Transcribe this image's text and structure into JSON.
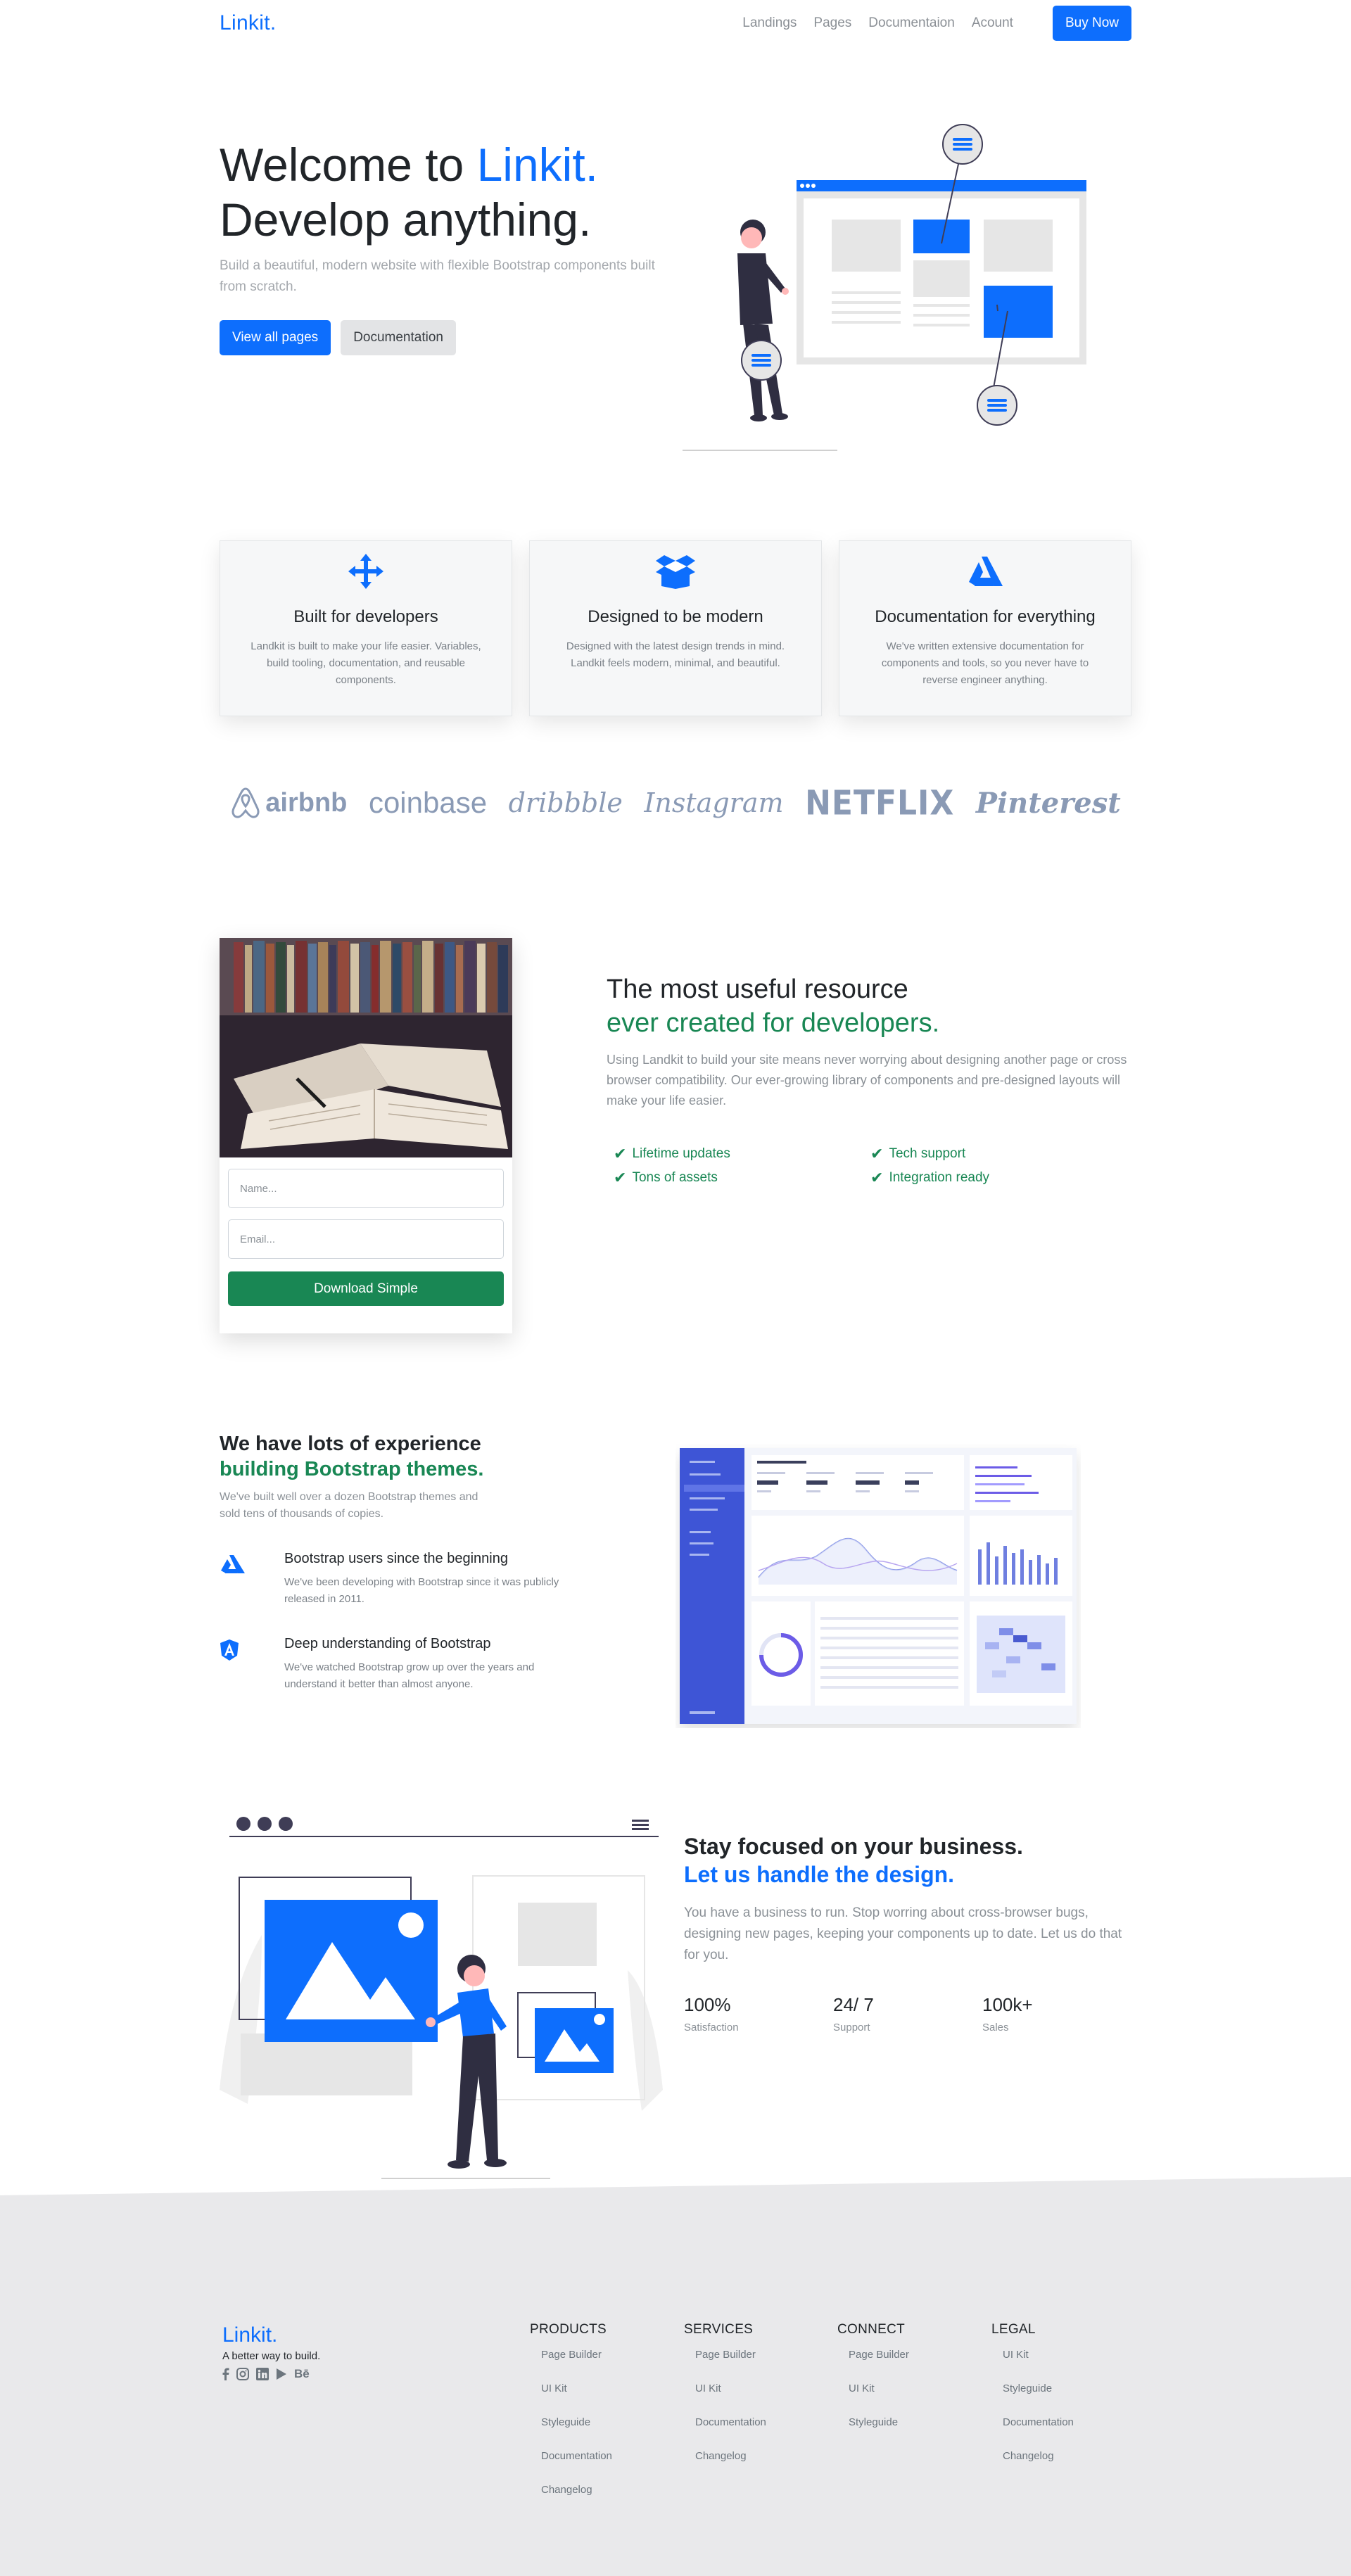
{
  "nav": {
    "brand": "Linkit.",
    "links": [
      "Landings",
      "Pages",
      "Documentaion",
      "Acount"
    ],
    "buy": "Buy Now"
  },
  "hero": {
    "title_prefix": "Welcome to ",
    "title_accent": "Linkit.",
    "title_line2": "Develop anything.",
    "subtitle": "Build a beautiful, modern website with flexible Bootstrap components built from scratch.",
    "btn_primary": "View all pages",
    "btn_secondary": "Documentation"
  },
  "features": [
    {
      "icon": "arrows-move-icon",
      "title": "Built for developers",
      "text": "Landkit is built to make your life easier. Variables, build tooling, documentation, and reusable components."
    },
    {
      "icon": "box-icon",
      "title": "Designed to be modern",
      "text": "Designed with the latest design trends in mind. Landkit feels modern, minimal, and beautiful."
    },
    {
      "icon": "documentation-icon",
      "title": "Documentation for everything",
      "text": "We've written extensive documentation for components and tools, so you never have to reverse engineer anything."
    }
  ],
  "logos": [
    "airbnb",
    "coinbase",
    "dribbble",
    "Instagram",
    "NETFLIX",
    "Pinterest"
  ],
  "resource": {
    "name_placeholder": "Name...",
    "email_placeholder": "Email...",
    "button": "Download Simple",
    "heading1": "The most useful resource",
    "heading2": "ever created for developers.",
    "paragraph": "Using Landkit to build your site means never worrying about designing another page or cross browser compatibility. Our ever-growing library of components and pre-designed layouts will make your life easier.",
    "checks": [
      "Lifetime updates",
      "Tech support",
      "Tons of assets",
      "Integration ready"
    ]
  },
  "experience": {
    "heading1": "We have lots of experience",
    "heading2": "building Bootstrap themes.",
    "subtitle": "We've built well over a dozen Bootstrap themes and sold tens of thousands of copies.",
    "items": [
      {
        "title": "Bootstrap users since the beginning",
        "text": "We've been developing with Bootstrap since it was publicly released in 2011."
      },
      {
        "title": "Deep understanding of Bootstrap",
        "text": "We've watched Bootstrap grow up over the years and understand it better than almost anyone."
      }
    ]
  },
  "focus": {
    "heading1": "Stay focused on your business.",
    "heading2": "Let us handle the design.",
    "paragraph": "You have a business to run. Stop worring about cross-browser bugs, designing new pages, keeping your components up to date. Let us do that for you.",
    "stats": [
      {
        "value": "100%",
        "label": "Satisfaction"
      },
      {
        "value": "24/ 7",
        "label": "Support"
      },
      {
        "value": "100k+",
        "label": "Sales"
      }
    ]
  },
  "footer": {
    "brand": "Linkit.",
    "tagline": "A better way to build.",
    "columns": [
      {
        "title": "PRODUCTS",
        "links": [
          "Page Builder",
          "UI Kit",
          "Styleguide",
          "Documentation",
          "Changelog"
        ]
      },
      {
        "title": "SERVICES",
        "links": [
          "Page Builder",
          "UI Kit",
          "Documentation",
          "Changelog"
        ]
      },
      {
        "title": "CONNECT",
        "links": [
          "Page Builder",
          "UI Kit",
          "Styleguide"
        ]
      },
      {
        "title": "LEGAL",
        "links": [
          "UI Kit",
          "Styleguide",
          "Documentation",
          "Changelog"
        ]
      }
    ]
  },
  "colors": {
    "primary": "#0d6efd",
    "success": "#198754",
    "footer_bg": "#e9e9eb"
  }
}
